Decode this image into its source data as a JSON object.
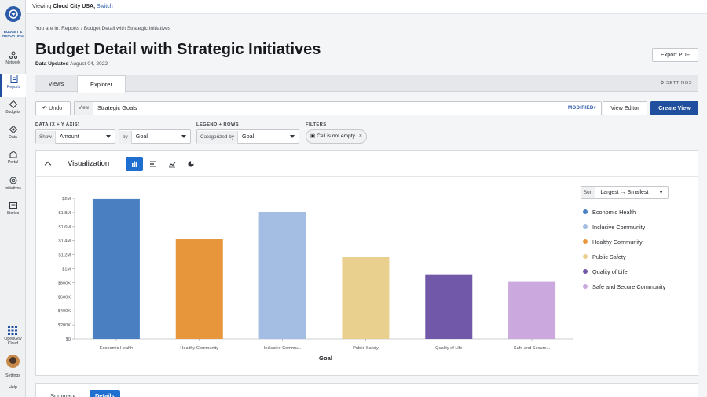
{
  "colors": {
    "accent": "#1f4f9e",
    "active_tab_blue": "#1f6fd1"
  },
  "sidebar": {
    "logo_text": "BUDGET & REPORTING",
    "items": [
      {
        "label": "Network",
        "icon": "network-icon"
      },
      {
        "label": "Reports",
        "icon": "reports-icon",
        "active": true
      },
      {
        "label": "Budgets",
        "icon": "budgets-icon"
      },
      {
        "label": "Data",
        "icon": "data-icon"
      },
      {
        "label": "Portal",
        "icon": "portal-icon"
      },
      {
        "label": "Initiatives",
        "icon": "initiatives-icon"
      },
      {
        "label": "Stories",
        "icon": "stories-icon"
      }
    ],
    "opengov_label": "OpenGov Cloud",
    "settings_label": "Settings",
    "help_label": "Help"
  },
  "topbar": {
    "viewing_prefix": "Viewing",
    "entity": "Cloud City USA,",
    "switch_label": "Switch"
  },
  "breadcrumb": {
    "prefix": "You are in:",
    "reports": "Reports",
    "separator": "/",
    "current": "Budget Detail with Strategic Initiatives"
  },
  "page": {
    "title": "Budget Detail with Strategic Initiatives",
    "updated_label": "Data Updated",
    "updated_date": "August 04, 2022",
    "export_label": "Export PDF"
  },
  "tabs": {
    "views": "Views",
    "explorer": "Explorer",
    "settings": "SETTINGS"
  },
  "toolbar": {
    "undo": "Undo",
    "view_label": "View",
    "view_value": "Strategic Goals",
    "modified": "MODIFIED",
    "view_editor": "View Editor",
    "create_view": "Create View"
  },
  "controls": {
    "data_label": "DATA (X + Y AXIS)",
    "show_label": "Show",
    "show_value": "Amount",
    "by_label": "by",
    "by_value": "Goal",
    "legend_label": "LEGEND + ROWS",
    "categorized_label": "Categorized by",
    "categorized_value": "Goal",
    "filters_label": "FILTERS",
    "filter_chip": "Cell is not empty"
  },
  "viz": {
    "title": "Visualization",
    "sort_label": "Sort",
    "sort_value": "Largest → Smallest"
  },
  "chart_data": {
    "type": "bar",
    "categories": [
      "Economic Health",
      "Healthy Community",
      "Inclusive Commu...",
      "Public Safety",
      "Quality of Life",
      "Safe and Secure..."
    ],
    "values": [
      1990000,
      1420000,
      1810000,
      1170000,
      920000,
      820000
    ],
    "colors": [
      "#4a80c2",
      "#e8963c",
      "#a4bde3",
      "#ead08f",
      "#7258a8",
      "#cba8dd"
    ],
    "xlabel": "Goal",
    "ylabel": "",
    "ylim": [
      0,
      2000000
    ],
    "yticks": [
      "$0",
      "$200K",
      "$400K",
      "$600K",
      "$800K",
      "$1M",
      "$1.2M",
      "$1.4M",
      "$1.6M",
      "$1.8M",
      "$2M"
    ],
    "legend": [
      {
        "name": "Economic Health",
        "color": "#4a80c2"
      },
      {
        "name": "Inclusive Community",
        "color": "#a4bde3"
      },
      {
        "name": "Healthy Community",
        "color": "#e8963c"
      },
      {
        "name": "Public Safety",
        "color": "#ead08f"
      },
      {
        "name": "Quality of Life",
        "color": "#7258a8"
      },
      {
        "name": "Safe and Secure Community",
        "color": "#cba8dd"
      }
    ],
    "legend_position": "right",
    "grid": false
  },
  "bottom_tabs": {
    "summary": "Summary",
    "details": "Details"
  }
}
